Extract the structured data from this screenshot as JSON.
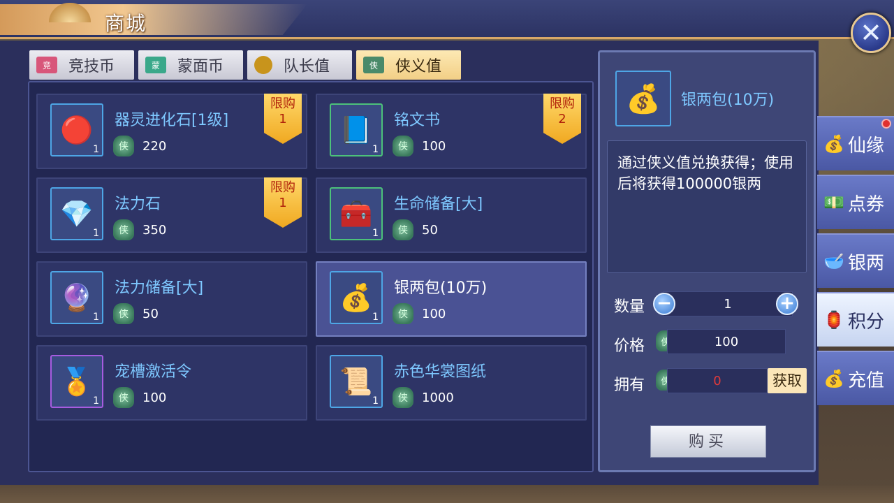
{
  "header": {
    "title": "商城"
  },
  "tabs": [
    {
      "label": "竞技币",
      "icon": "jing-ticket-icon",
      "icon_text": "竞",
      "color": "#d8567a"
    },
    {
      "label": "蒙面币",
      "icon": "mask-ticket-icon",
      "icon_text": "蒙",
      "color": "#3aa88a"
    },
    {
      "label": "队长值",
      "icon": "gold-coin-icon",
      "icon_text": "",
      "color": "#c8941c"
    },
    {
      "label": "侠义值",
      "icon": "xia-token-icon",
      "icon_text": "侠",
      "color": "#4a8a6a",
      "active": true
    }
  ],
  "items": [
    {
      "name": "器灵进化石[1级]",
      "count": "1",
      "price": "220",
      "limit": "限购\n1",
      "icon": "🔴"
    },
    {
      "name": "铭文书",
      "count": "1",
      "price": "100",
      "limit": "限购\n2",
      "icon": "📘"
    },
    {
      "name": "法力石",
      "count": "1",
      "price": "350",
      "limit": "限购\n1",
      "icon": "💎"
    },
    {
      "name": "生命储备[大]",
      "count": "1",
      "price": "50",
      "icon": "🧰"
    },
    {
      "name": "法力储备[大]",
      "count": "1",
      "price": "50",
      "icon": "🔮"
    },
    {
      "name": "银两包(10万)",
      "count": "1",
      "price": "100",
      "icon": "💰"
    },
    {
      "name": "宠槽激活令",
      "count": "1",
      "price": "100",
      "icon": "🏅"
    },
    {
      "name": "赤色华裳图纸",
      "count": "1",
      "price": "1000",
      "icon": "📜"
    }
  ],
  "detail": {
    "name": "银两包(10万)",
    "description": "通过侠义值兑换获得；使用后将获得100000银两",
    "quantity_label": "数量",
    "quantity": "1",
    "price_label": "价格",
    "price": "100",
    "owned_label": "拥有",
    "owned": "0",
    "get_label": "获取",
    "buy_label": "购买",
    "minus": "−",
    "plus": "+"
  },
  "coin_glyph": "侠",
  "side_tabs": [
    {
      "label": "仙缘",
      "icon": "💰"
    },
    {
      "label": "点券",
      "icon": "💵"
    },
    {
      "label": "银两",
      "icon": "🥣"
    },
    {
      "label": "积分",
      "icon": "🏮",
      "active": true
    },
    {
      "label": "充值",
      "icon": "💰"
    }
  ],
  "close_glyph": "✕"
}
